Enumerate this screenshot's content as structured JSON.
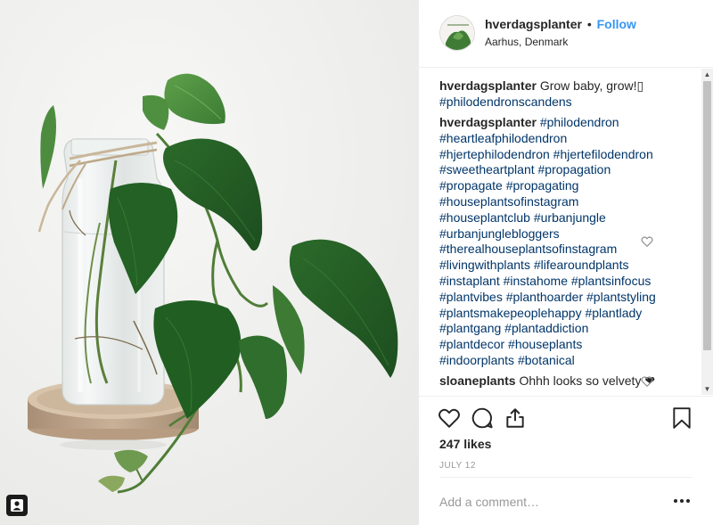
{
  "post": {
    "username": "hverdagsplanter",
    "follow_label": "Follow",
    "separator": "•",
    "location": "Aarhus, Denmark"
  },
  "comments": [
    {
      "user": "hverdagsplanter",
      "text": "Grow baby, grow!",
      "trailing_glyph": "▯",
      "lines": [
        "#philodendronscandens"
      ]
    },
    {
      "user": "hverdagsplanter",
      "first": "#philodendron",
      "lines": [
        "#heartleafphilodendron",
        "#hjertephilodendron #hjertefilodendron",
        "#sweetheartplant #propagation",
        "#propagate #propagating",
        "#houseplantsofinstagram",
        "#houseplantclub #urbanjungle",
        "#urbanjunglebloggers",
        "#therealhouseplantsofinstagram",
        "#livingwithplants #lifearoundplants",
        "#instaplant #instahome #plantsinfocus",
        "#plantvibes #planthoarder #plantstyling",
        "#plantsmakepeoplehappy #plantlady",
        "#plantgang #plantaddiction",
        "#plantdecor #houseplants",
        "#indoorplants #botanical"
      ]
    },
    {
      "user": "sloaneplants",
      "text": "Ohhh looks so velvety ❤"
    }
  ],
  "likes": "247 likes",
  "date": "JULY 12",
  "add_comment_placeholder": "Add a comment…",
  "icons": {
    "like": "heart-icon",
    "comment": "comment-bubble-icon",
    "share": "share-icon",
    "save": "bookmark-icon",
    "more": "more-options-icon",
    "tagged_user": "person-tag-icon",
    "comment_like": "heart-outline-icon"
  },
  "colors": {
    "link_blue": "#3897f0",
    "hashtag": "#003569",
    "text": "#262626",
    "muted": "#999999",
    "leaf_green": "#2e6a2c"
  }
}
